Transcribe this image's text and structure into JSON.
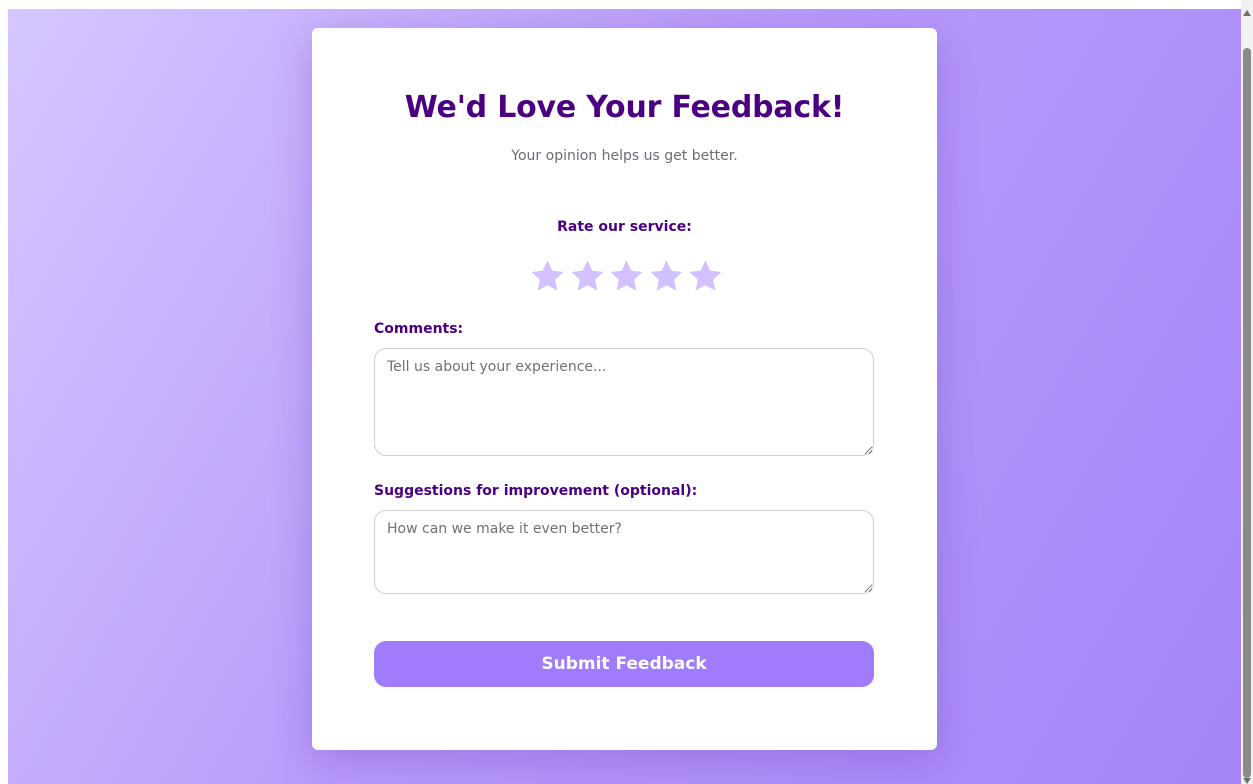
{
  "form": {
    "title": "We'd Love Your Feedback!",
    "subtitle": "Your opinion helps us get better.",
    "rating": {
      "label": "Rate our service:",
      "max_stars": 5,
      "selected": 0,
      "star_icon": "star-icon",
      "star_color": "#d3c1ff"
    },
    "comments": {
      "label": "Comments:",
      "placeholder": "Tell us about your experience...",
      "value": ""
    },
    "suggestions": {
      "label": "Suggestions for improvement (optional):",
      "placeholder": "How can we make it even better?",
      "value": ""
    },
    "submit_label": "Submit Feedback"
  },
  "colors": {
    "accent": "#4b0082",
    "button": "#a07cfc",
    "background_start": "#d6c6ff",
    "background_end": "#a585f7"
  }
}
